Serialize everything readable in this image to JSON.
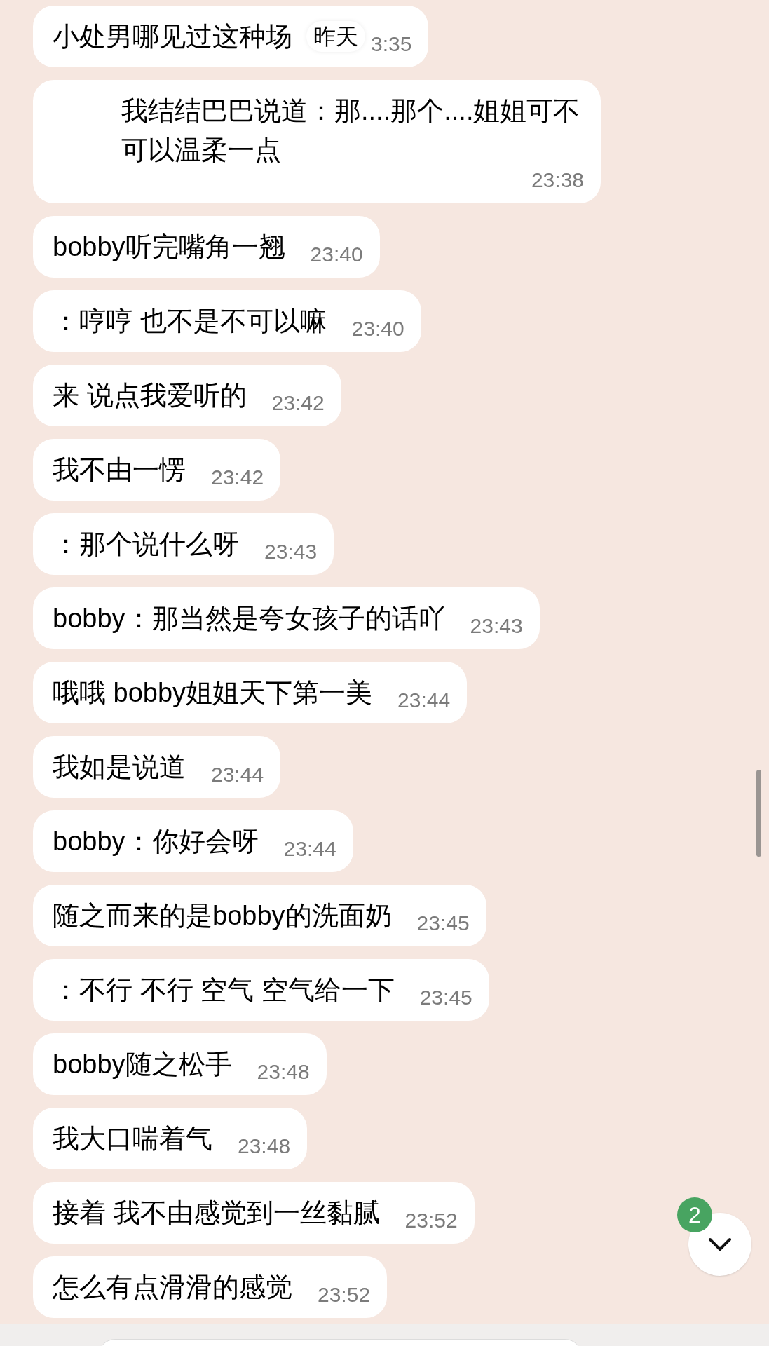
{
  "date_chip": "昨天",
  "messages": [
    {
      "text": "小处男哪见过这种场",
      "time": "3:35"
    },
    {
      "text": "我结结巴巴说道：那....那个....姐姐可不可以温柔一点",
      "time": "23:38"
    },
    {
      "text": "bobby听完嘴角一翘",
      "time": "23:40"
    },
    {
      "text": "：哼哼 也不是不可以嘛",
      "time": "23:40"
    },
    {
      "text": "来 说点我爱听的",
      "time": "23:42"
    },
    {
      "text": "我不由一愣",
      "time": "23:42"
    },
    {
      "text": "：那个说什么呀",
      "time": "23:43"
    },
    {
      "text": "bobby：那当然是夸女孩子的话吖",
      "time": "23:43"
    },
    {
      "text": "哦哦 bobby姐姐天下第一美",
      "time": "23:44"
    },
    {
      "text": "我如是说道",
      "time": "23:44"
    },
    {
      "text": "bobby：你好会呀",
      "time": "23:44"
    },
    {
      "text": "随之而来的是bobby的洗面奶",
      "time": "23:45"
    },
    {
      "text": "：不行 不行 空气 空气给一下",
      "time": "23:45"
    },
    {
      "text": "bobby随之松手",
      "time": "23:48"
    },
    {
      "text": "我大口喘着气",
      "time": "23:48"
    },
    {
      "text": "接着 我不由感觉到一丝黏腻",
      "time": "23:52"
    },
    {
      "text": "怎么有点滑滑的感觉",
      "time": "23:52"
    }
  ],
  "scroll_button": {
    "badge": "2"
  }
}
